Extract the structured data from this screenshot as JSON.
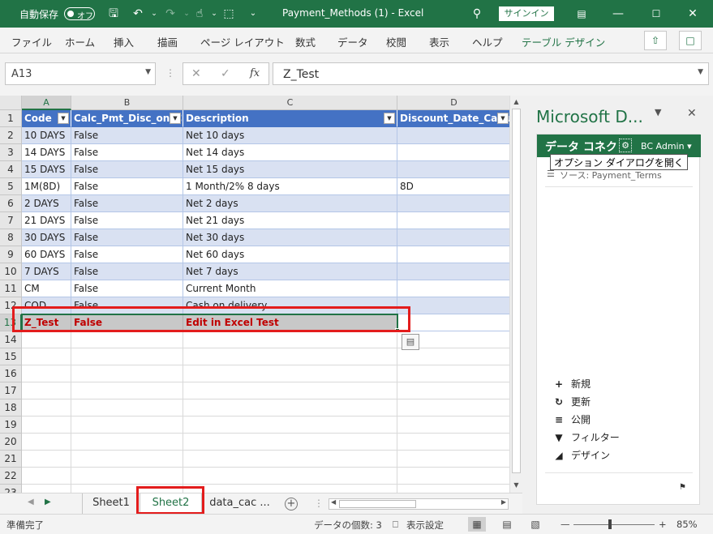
{
  "titlebar": {
    "autosave_label": "自動保存",
    "autosave_state": "オフ",
    "title": "Payment_Methods (1)  -  Excel",
    "signin": "サインイン",
    "icons": [
      "save-icon",
      "undo-icon",
      "redo-icon",
      "touch-mode-icon",
      "select-icon",
      "customize-icon",
      "search-icon",
      "ribbon-display-icon",
      "minimize-icon",
      "maximize-icon",
      "close-icon"
    ]
  },
  "ribbon": {
    "tabs": [
      "ファイル",
      "ホーム",
      "挿入",
      "描画",
      "ページ レイアウト",
      "数式",
      "データ",
      "校閲",
      "表示",
      "ヘルプ",
      "テーブル デザイン"
    ]
  },
  "formula_bar": {
    "name_box": "A13",
    "fx": "fx",
    "value": "Z_Test"
  },
  "grid": {
    "columns": [
      "A",
      "B",
      "C",
      "D"
    ],
    "rows": [
      "1",
      "2",
      "3",
      "4",
      "5",
      "6",
      "7",
      "8",
      "9",
      "10",
      "11",
      "12",
      "13",
      "14",
      "15",
      "16",
      "17",
      "18",
      "19",
      "20",
      "21",
      "22",
      "23"
    ],
    "header": [
      "Code",
      "Calc_Pmt_Disc_on_C",
      "Description",
      "Discount_Date_Calcula"
    ],
    "data": [
      [
        "10 DAYS",
        "False",
        "Net 10 days",
        ""
      ],
      [
        "14 DAYS",
        "False",
        "Net 14 days",
        ""
      ],
      [
        "15 DAYS",
        "False",
        "Net 15 days",
        ""
      ],
      [
        "1M(8D)",
        "False",
        "1 Month/2% 8 days",
        "8D"
      ],
      [
        "2 DAYS",
        "False",
        "Net 2 days",
        ""
      ],
      [
        "21 DAYS",
        "False",
        "Net 21 days",
        ""
      ],
      [
        "30 DAYS",
        "False",
        "Net 30 days",
        ""
      ],
      [
        "60 DAYS",
        "False",
        "Net 60 days",
        ""
      ],
      [
        "7 DAYS",
        "False",
        "Net 7 days",
        ""
      ],
      [
        "CM",
        "False",
        "Current Month",
        ""
      ],
      [
        "COD",
        "False",
        "Cash on delivery",
        ""
      ],
      [
        "Z_Test",
        "False",
        "Edit in Excel Test",
        ""
      ]
    ]
  },
  "sheets": {
    "tabs": [
      "Sheet1",
      "Sheet2",
      "data_cac ..."
    ],
    "active": "Sheet2"
  },
  "status": {
    "ready": "準備完了",
    "count": "データの個数: 3",
    "display_settings": "表示設定",
    "zoom": "85%"
  },
  "pane": {
    "title": "Microsoft D...",
    "group_title": "データ コネク",
    "account": "BC Admin",
    "tooltip": "オプション ダイアログを開く",
    "source": "ソース: Payment_Terms",
    "actions": [
      {
        "icon": "plus-icon",
        "label": "新規"
      },
      {
        "icon": "refresh-icon",
        "label": "更新"
      },
      {
        "icon": "publish-icon",
        "label": "公開"
      },
      {
        "icon": "filter-icon",
        "label": "フィルター"
      },
      {
        "icon": "design-icon",
        "label": "デザイン"
      }
    ]
  },
  "colors": {
    "excel_green": "#217346",
    "table_header": "#4472c4",
    "band": "#d9e1f2",
    "highlight_red": "#e31c1c",
    "edit_text": "#c00000"
  }
}
